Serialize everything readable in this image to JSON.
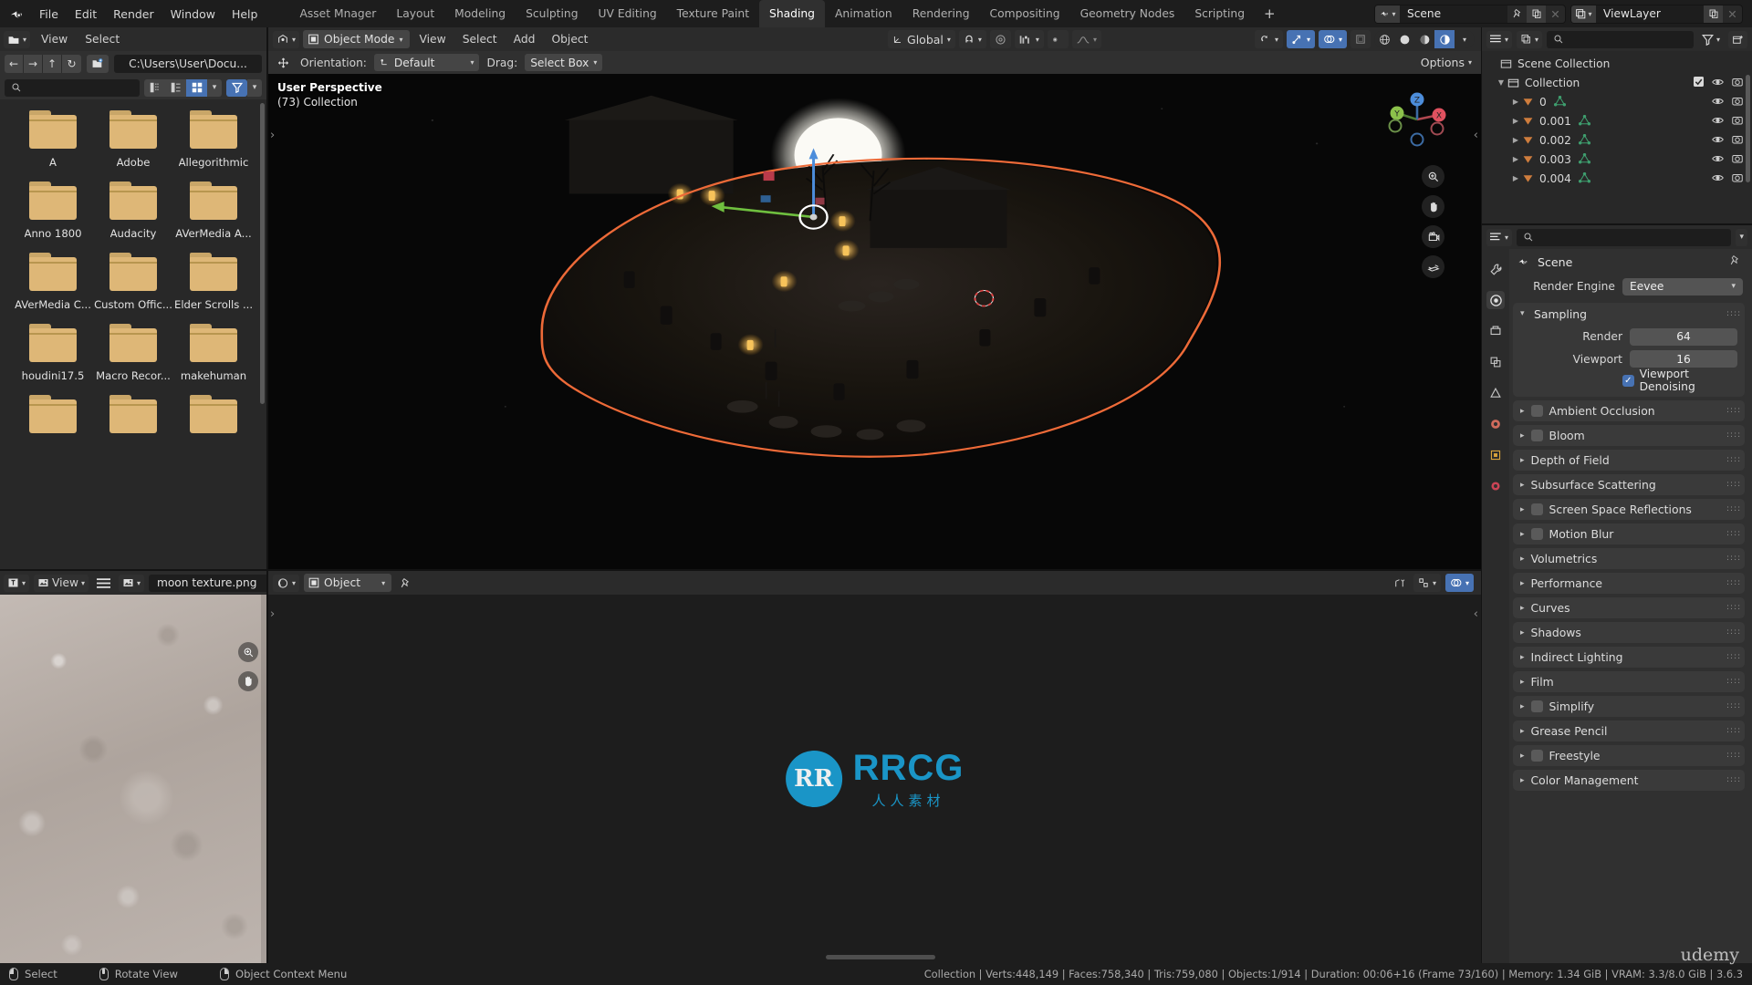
{
  "topbar": {
    "logo_icon": "blender-logo-icon",
    "menus": [
      "File",
      "Edit",
      "Render",
      "Window",
      "Help"
    ],
    "workspaces": [
      {
        "label": "Asset Mnager",
        "active": false
      },
      {
        "label": "Layout",
        "active": false
      },
      {
        "label": "Modeling",
        "active": false
      },
      {
        "label": "Sculpting",
        "active": false
      },
      {
        "label": "UV Editing",
        "active": false
      },
      {
        "label": "Texture Paint",
        "active": false
      },
      {
        "label": "Shading",
        "active": true
      },
      {
        "label": "Animation",
        "active": false
      },
      {
        "label": "Rendering",
        "active": false
      },
      {
        "label": "Compositing",
        "active": false
      },
      {
        "label": "Geometry Nodes",
        "active": false
      },
      {
        "label": "Scripting",
        "active": false
      }
    ],
    "add_workspace_label": "+",
    "scene": {
      "icon": "scene-icon",
      "name": "Scene",
      "pin_icon": "pin-icon",
      "copy_icon": "duplicate-icon",
      "close_icon": "x-icon"
    },
    "viewlayer": {
      "icon": "viewlayer-icon",
      "name": "ViewLayer",
      "copy_icon": "duplicate-icon",
      "close_icon": "x-icon"
    }
  },
  "filebrowser": {
    "editor_icon": "file-browser-icon",
    "menus": [
      "View",
      "Select"
    ],
    "nav": {
      "back": "←",
      "forward": "→",
      "up": "↑",
      "refresh": "↻",
      "new_folder_icon": "new-folder-icon"
    },
    "path": "C:\\Users\\User\\Docu...",
    "search_placeholder": "",
    "display_modes": [
      "vertical-list-icon",
      "horizontal-list-icon",
      "thumbnail-grid-icon"
    ],
    "display_mode_active": "thumbnail-grid-icon",
    "filter_icon": "filter-icon",
    "filter_enabled": true,
    "files": [
      "A",
      "Adobe",
      "Allegorithmic",
      "Anno 1800",
      "Audacity",
      "AVerMedia A...",
      "AVerMedia C...",
      "Custom Offic...",
      "Elder Scrolls ...",
      "houdini17.5",
      "Macro Recor...",
      "makehuman"
    ]
  },
  "image_editor": {
    "editor_icon": "image-editor-icon",
    "view_mode_icon": "image-icon",
    "view_menu": "View",
    "hamburger_icon": "menu-icon",
    "browse_icon": "browse-image-icon",
    "image_name": "moon texture.png",
    "zoom_icon": "zoom-icon",
    "pan_icon": "hand-icon"
  },
  "viewport": {
    "editor_icon": "3d-viewport-icon",
    "mode": "Object Mode",
    "menus": [
      "View",
      "Select",
      "Add",
      "Object"
    ],
    "transform_orientation": "Global",
    "snap_icon": "magnet-icon",
    "proportional_icon": "proportional-edit-icon",
    "overlay_icons": [
      "visibility-icon",
      "gizmo-icon",
      "overlays-icon",
      "xray-icon"
    ],
    "shading_modes": [
      "wireframe-icon",
      "solid-icon",
      "material-preview-icon",
      "rendered-icon"
    ],
    "shading_active": "rendered-icon",
    "tool_settings": {
      "active_tool_icon": "tweak-tool-icon",
      "orientation_label": "Orientation:",
      "orientation_value": "Default",
      "drag_label": "Drag:",
      "drag_value": "Select Box",
      "options_label": "Options"
    },
    "overlay_text": {
      "perspective": "User Perspective",
      "collection": "(73) Collection"
    },
    "gizmo_axes": [
      {
        "label": "X",
        "color": "#e0515f"
      },
      {
        "label": "Y",
        "color": "#8cc14b"
      },
      {
        "label": "Z",
        "color": "#4c8ddb"
      }
    ],
    "nav_tools": [
      "zoom-icon",
      "hand-icon",
      "camera-icon",
      "ortho-persp-icon"
    ]
  },
  "shader_editor": {
    "editor_icon": "shader-editor-icon",
    "shader_type_icon": "object-icon",
    "shader_type": "Object",
    "pin_icon": "pin-icon",
    "snap_icon": "snap-icon",
    "overlay_icon": "overlays-icon",
    "watermark": {
      "initials": "RR",
      "brand": "RRCG",
      "sub": "人人素材"
    }
  },
  "outliner": {
    "editor_icon": "outliner-icon",
    "display_mode_icon": "view-layer-icon",
    "search_placeholder": "",
    "filter_icon": "filter-icon",
    "new_collection_icon": "new-collection-icon",
    "rows": [
      {
        "label": "Scene Collection",
        "indent": 0,
        "icon": "scene-collection-icon",
        "expander": "",
        "has_checkbox": false,
        "has_mesh": false,
        "visible": false
      },
      {
        "label": "Collection",
        "indent": 1,
        "icon": "collection-icon",
        "expander": "▼",
        "has_checkbox": true,
        "has_mesh": false,
        "visible": true
      },
      {
        "label": "0",
        "indent": 2,
        "icon": "object-icon",
        "expander": "▶",
        "has_checkbox": false,
        "has_mesh": true,
        "visible": true
      },
      {
        "label": "0.001",
        "indent": 2,
        "icon": "object-icon",
        "expander": "▶",
        "has_checkbox": false,
        "has_mesh": true,
        "visible": true
      },
      {
        "label": "0.002",
        "indent": 2,
        "icon": "object-icon",
        "expander": "▶",
        "has_checkbox": false,
        "has_mesh": true,
        "visible": true
      },
      {
        "label": "0.003",
        "indent": 2,
        "icon": "object-icon",
        "expander": "▶",
        "has_checkbox": false,
        "has_mesh": true,
        "visible": true
      },
      {
        "label": "0.004",
        "indent": 2,
        "icon": "object-icon",
        "expander": "▶",
        "has_checkbox": false,
        "has_mesh": true,
        "visible": true
      }
    ]
  },
  "properties": {
    "editor_icon": "properties-icon",
    "search_placeholder": "",
    "tabs": [
      {
        "name": "tool-tab",
        "glyph": "⚒",
        "color": "#c8c8c8",
        "active": false
      },
      {
        "name": "render-tab",
        "glyph": "◉",
        "color": "#d8d8d8",
        "active": true
      },
      {
        "name": "output-tab",
        "glyph": "⎙",
        "color": "#c8c8c8",
        "active": false
      },
      {
        "name": "view-layer-tab",
        "glyph": "❑",
        "color": "#c8c8c8",
        "active": false
      },
      {
        "name": "scene-tab",
        "glyph": "△",
        "color": "#c8c8c8",
        "active": false
      },
      {
        "name": "world-tab",
        "glyph": "●",
        "color": "#cf6b5c",
        "active": false
      },
      {
        "name": "object-tab",
        "glyph": "▣",
        "color": "#d8a23c",
        "active": false
      },
      {
        "name": "material-tab",
        "glyph": "●",
        "color": "#cc4455",
        "active": false
      }
    ],
    "header": {
      "icon": "scene-icon",
      "title": "Scene",
      "pin_icon": "pin-icon"
    },
    "render_engine": {
      "label": "Render Engine",
      "value": "Eevee"
    },
    "sampling": {
      "title": "Sampling",
      "expanded": true,
      "render": {
        "label": "Render",
        "value": "64"
      },
      "viewport": {
        "label": "Viewport",
        "value": "16"
      },
      "denoising": {
        "label": "Viewport Denoising",
        "checked": true
      }
    },
    "panels": [
      {
        "label": "Ambient Occlusion",
        "has_checkbox": true,
        "checked": false
      },
      {
        "label": "Bloom",
        "has_checkbox": true,
        "checked": false
      },
      {
        "label": "Depth of Field",
        "has_checkbox": false,
        "checked": false
      },
      {
        "label": "Subsurface Scattering",
        "has_checkbox": false,
        "checked": false
      },
      {
        "label": "Screen Space Reflections",
        "has_checkbox": true,
        "checked": false
      },
      {
        "label": "Motion Blur",
        "has_checkbox": true,
        "checked": false
      },
      {
        "label": "Volumetrics",
        "has_checkbox": false,
        "checked": false
      },
      {
        "label": "Performance",
        "has_checkbox": false,
        "checked": false
      },
      {
        "label": "Curves",
        "has_checkbox": false,
        "checked": false
      },
      {
        "label": "Shadows",
        "has_checkbox": false,
        "checked": false
      },
      {
        "label": "Indirect Lighting",
        "has_checkbox": false,
        "checked": false
      },
      {
        "label": "Film",
        "has_checkbox": false,
        "checked": false
      },
      {
        "label": "Simplify",
        "has_checkbox": true,
        "checked": false
      },
      {
        "label": "Grease Pencil",
        "has_checkbox": false,
        "checked": false
      },
      {
        "label": "Freestyle",
        "has_checkbox": true,
        "checked": false
      },
      {
        "label": "Color Management",
        "has_checkbox": false,
        "checked": false
      }
    ]
  },
  "statusbar": {
    "keymap": [
      {
        "icon": "mouse-left-icon",
        "label": "Select"
      },
      {
        "icon": "mouse-middle-icon",
        "label": "Rotate View"
      },
      {
        "icon": "mouse-right-icon",
        "label": "Object Context Menu"
      }
    ],
    "stats": "Collection | Verts:448,149 | Faces:758,340 | Tris:759,080 | Objects:1/914 | Duration: 00:06+16 (Frame 73/160) | Memory: 1.34 GiB | VRAM: 3.3/8.0 GiB | 3.6.3",
    "watermark": "udemy"
  }
}
